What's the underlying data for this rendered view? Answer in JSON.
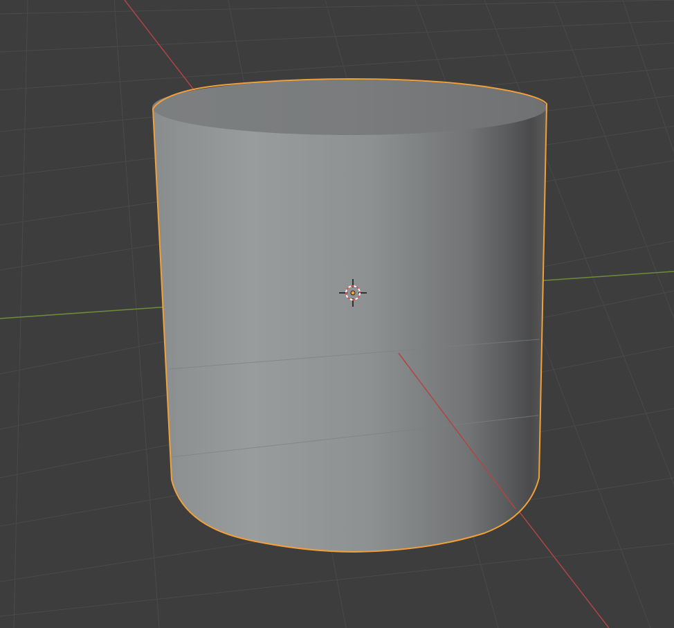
{
  "viewport": {
    "background_color": "#3d3d3d",
    "grid_line_color": "#4a4a4a",
    "x_axis_color": "#b04545",
    "y_axis_color": "#6e8c3a",
    "selection_outline_color": "#f2a13a",
    "object_base_color": "#8f9293",
    "object_name": "Cylinder",
    "selected": true
  },
  "cursor_3d": {
    "icon": "3d-cursor-icon",
    "ring_colors": [
      "#ffffff",
      "#e05050"
    ]
  },
  "origin": {
    "icon": "object-origin-icon",
    "color": "#f2a13a"
  }
}
